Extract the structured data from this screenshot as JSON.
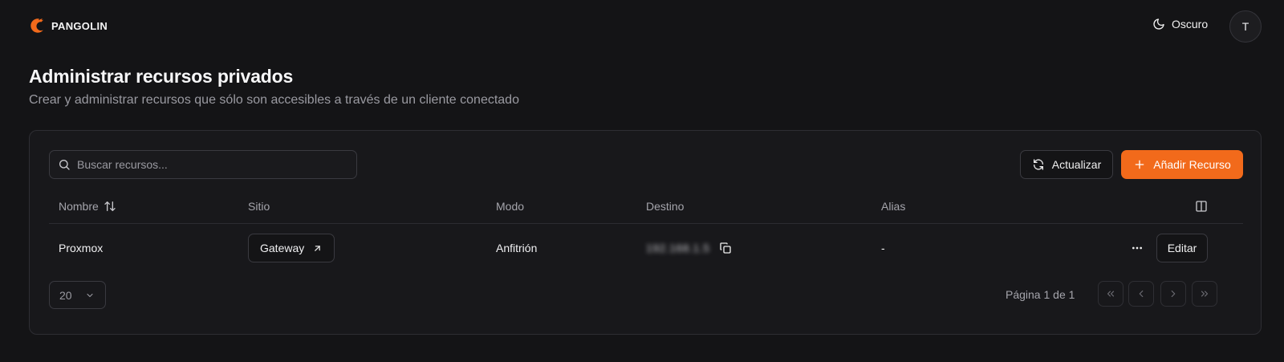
{
  "app": {
    "name": "PANGOLIN"
  },
  "header": {
    "theme_label": "Oscuro",
    "avatar_initial": "T"
  },
  "page": {
    "title": "Administrar recursos privados",
    "subtitle": "Crear y administrar recursos que sólo son accesibles a través de un cliente conectado"
  },
  "toolbar": {
    "search_placeholder": "Buscar recursos...",
    "refresh_label": "Actualizar",
    "add_label": "Añadir Recurso"
  },
  "table": {
    "columns": [
      "Nombre",
      "Sitio",
      "Modo",
      "Destino",
      "Alias"
    ],
    "rows": [
      {
        "nombre": "Proxmox",
        "sitio": "Gateway",
        "modo": "Anfitrión",
        "destino": "192.168.1.5",
        "alias": "-",
        "edit_label": "Editar"
      }
    ]
  },
  "pagination": {
    "page_size": "20",
    "page_info": "Página 1 de 1"
  },
  "colors": {
    "accent": "#f26a1b",
    "background": "#141416",
    "card": "#18181b",
    "border": "#2e2e33"
  },
  "icons": {
    "logo": "pangolin-logo-icon",
    "theme": "moon-icon",
    "search": "search-icon",
    "refresh": "refresh-icon",
    "add": "plus-icon",
    "sort": "sort-icon",
    "columns": "columns-icon",
    "external": "arrow-up-right-icon",
    "copy": "copy-icon",
    "more": "more-horizontal-icon"
  }
}
